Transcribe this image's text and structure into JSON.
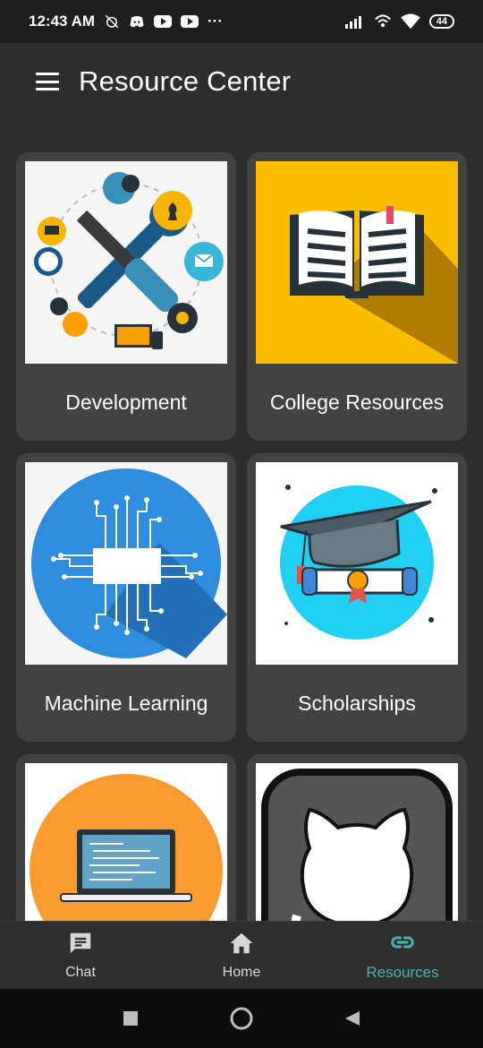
{
  "status_bar": {
    "time": "12:43 AM",
    "more": "···",
    "battery": "44",
    "icons": [
      "alarm-off-icon",
      "discord-icon",
      "youtube-icon",
      "youtube-icon",
      "signal-icon",
      "hotspot-icon",
      "wifi-icon",
      "battery-icon"
    ]
  },
  "app_bar": {
    "title": "Resource Center",
    "menu_icon": "hamburger-menu-icon"
  },
  "cards": [
    {
      "label": "Development",
      "icon": "tools-illustration"
    },
    {
      "label": "College Resources",
      "icon": "open-book-illustration"
    },
    {
      "label": "Machine Learning",
      "icon": "circuit-chip-illustration"
    },
    {
      "label": "Scholarships",
      "icon": "graduation-cap-illustration"
    },
    {
      "label": "",
      "icon": "laptop-code-illustration"
    },
    {
      "label": "",
      "icon": "github-octocat-illustration"
    }
  ],
  "bottom_nav": {
    "items": [
      {
        "label": "Chat",
        "icon": "chat-icon",
        "active": false
      },
      {
        "label": "Home",
        "icon": "home-icon",
        "active": false
      },
      {
        "label": "Resources",
        "icon": "link-icon",
        "active": true
      }
    ]
  },
  "colors": {
    "background": "#2e2e2e",
    "card": "#424242",
    "accent": "#4fb4a6",
    "status_bar": "#1f1f1f"
  }
}
